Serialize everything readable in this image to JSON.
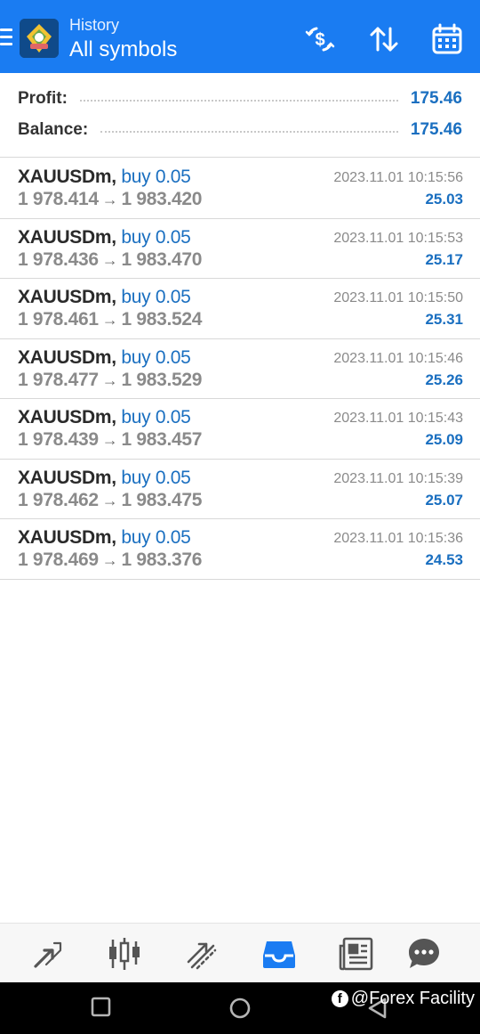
{
  "header": {
    "subtitle": "History",
    "title": "All symbols",
    "brand_color": "#1a7cf2",
    "icons": [
      "menu-icon",
      "app-logo",
      "dollar-refresh-icon",
      "sort-icon",
      "calendar-icon"
    ]
  },
  "summary": {
    "profit_label": "Profit:",
    "profit_value": "175.46",
    "balance_label": "Balance:",
    "balance_value": "175.46"
  },
  "deals": [
    {
      "symbol": "XAUUSDm,",
      "side": "buy 0.05",
      "open": "1 978.414",
      "close": "1 983.420",
      "time": "2023.11.01 10:15:56",
      "profit": "25.03"
    },
    {
      "symbol": "XAUUSDm,",
      "side": "buy 0.05",
      "open": "1 978.436",
      "close": "1 983.470",
      "time": "2023.11.01 10:15:53",
      "profit": "25.17"
    },
    {
      "symbol": "XAUUSDm,",
      "side": "buy 0.05",
      "open": "1 978.461",
      "close": "1 983.524",
      "time": "2023.11.01 10:15:50",
      "profit": "25.31"
    },
    {
      "symbol": "XAUUSDm,",
      "side": "buy 0.05",
      "open": "1 978.477",
      "close": "1 983.529",
      "time": "2023.11.01 10:15:46",
      "profit": "25.26"
    },
    {
      "symbol": "XAUUSDm,",
      "side": "buy 0.05",
      "open": "1 978.439",
      "close": "1 983.457",
      "time": "2023.11.01 10:15:43",
      "profit": "25.09"
    },
    {
      "symbol": "XAUUSDm,",
      "side": "buy 0.05",
      "open": "1 978.462",
      "close": "1 983.475",
      "time": "2023.11.01 10:15:39",
      "profit": "25.07"
    },
    {
      "symbol": "XAUUSDm,",
      "side": "buy 0.05",
      "open": "1 978.469",
      "close": "1 983.376",
      "time": "2023.11.01 10:15:36",
      "profit": "24.53"
    }
  ],
  "arrow": "→",
  "bottom_nav": {
    "items": [
      "quotes-icon",
      "chart-icon",
      "trade-icon",
      "history-icon",
      "news-icon",
      "chat-icon"
    ],
    "active": "history-icon",
    "active_color": "#1a7cf2"
  },
  "system_bar": {
    "buttons": [
      "recents-button",
      "home-button",
      "back-button"
    ]
  },
  "watermark": {
    "icon": "facebook-icon",
    "text": "@Forex Facility"
  }
}
